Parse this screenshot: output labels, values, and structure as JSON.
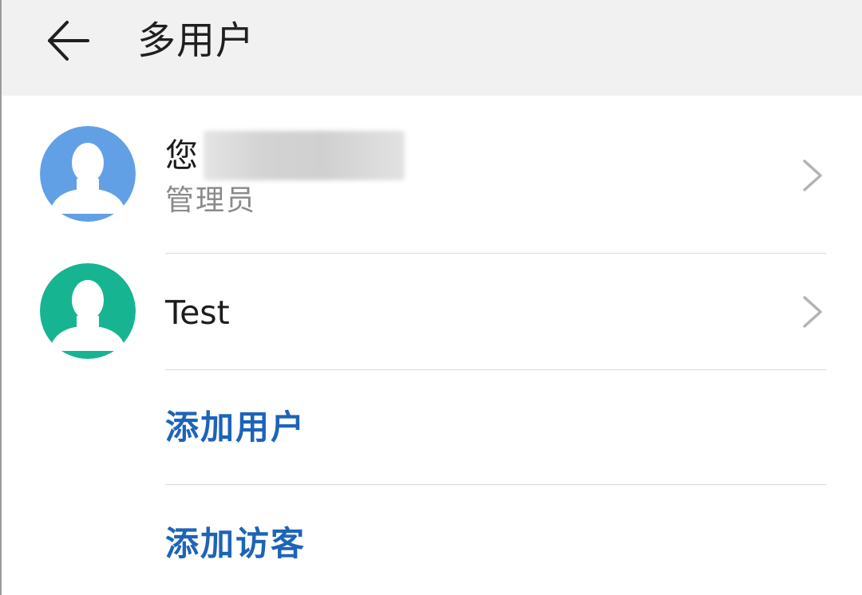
{
  "header": {
    "title": "多用户"
  },
  "users": [
    {
      "name": "您",
      "role": "管理员",
      "avatar_color": "#62a0e6",
      "name_redacted": true
    },
    {
      "name": "Test",
      "role": "",
      "avatar_color": "#17b492"
    }
  ],
  "actions": {
    "add_user": "添加用户",
    "add_guest": "添加访客"
  },
  "colors": {
    "header_bg": "#f1f1f1",
    "accent": "#1d64b8",
    "secondary_text": "#8a8a8a"
  }
}
